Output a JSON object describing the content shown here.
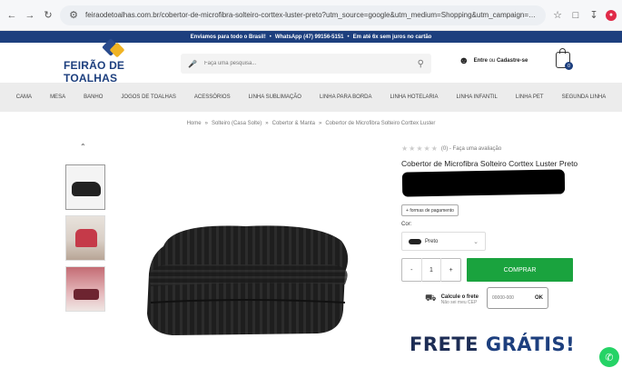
{
  "browser": {
    "url": "feiraodetoalhas.com.br/cobertor-de-microfibra-solteiro-corttex-luster-preto?utm_source=google&utm_medium=Shopping&utm_campaign=cobertor-de-microfibra-solteiro-corttex-lust..."
  },
  "topbar": {
    "text1": "Enviamos para todo o Brasil!",
    "sep": "•",
    "text2": "WhatsApp (47) 99156-5151",
    "text3": "Em até 6x sem juros no cartão"
  },
  "header": {
    "logo_text": "FEIRÃO DE TOALHAS",
    "search_placeholder": "Faça uma pesquisa...",
    "account_enter": "Entre",
    "account_or": "ou",
    "account_register": "Cadastre-se",
    "cart_count": "0"
  },
  "menu": [
    "CAMA",
    "MESA",
    "BANHO",
    "JOGOS DE TOALHAS",
    "ACESSÓRIOS",
    "LINHA SUBLIMAÇÃO",
    "LINHA PARA BORDA",
    "LINHA HOTELARIA",
    "LINHA INFANTIL",
    "LINHA PET",
    "SEGUNDA LINHA"
  ],
  "breadcrumb": [
    "Home",
    "Solteiro (Casa Solte)",
    "Cobertor & Manta",
    "Cobertor de Microfibra Solteiro Corttex Luster"
  ],
  "breadcrumb_sep": "»",
  "product": {
    "stars": "★★★★★",
    "reviews": "(0) - Faça uma avaliação",
    "title": "Cobertor de Microfibra Solteiro Corttex Luster Preto",
    "payment_button": "+ formas de pagamento",
    "color_label": "Cor:",
    "color_value": "Preto",
    "qty_minus": "-",
    "qty_value": "1",
    "qty_plus": "+",
    "buy_label": "COMPRAR",
    "freight_title": "Calcule o frete",
    "freight_sub": "Não sei meu CEP",
    "cep_placeholder": "00000-000",
    "cep_ok": "OK",
    "frete_word1": "FRETE",
    "frete_word2": "GRÁTIS!"
  }
}
